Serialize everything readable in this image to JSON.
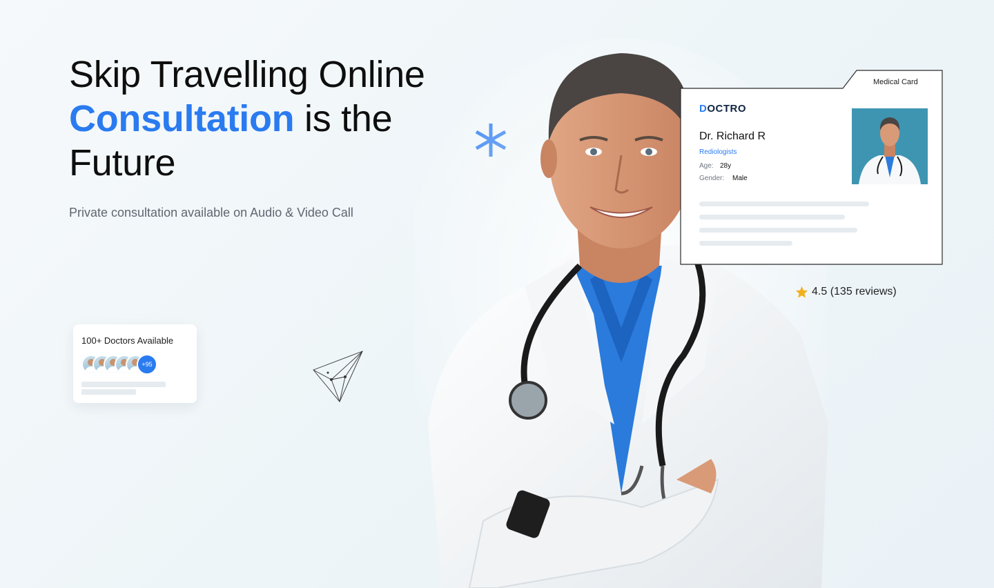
{
  "hero": {
    "title_line1": "Skip Travelling Online",
    "title_accent": "Consultation",
    "title_rest": " is the",
    "title_line3": "Future",
    "subtitle": "Private consultation available on Audio & Video Call"
  },
  "doctors_card": {
    "label": "100+ Doctors Available",
    "more_count": "+95"
  },
  "medical_card": {
    "tab_label": "Medical Card",
    "logo_first": "D",
    "logo_rest": "OCTRO",
    "doctor_name": "Dr. Richard R",
    "specialty": "Rediologists",
    "age_label": "Age:",
    "age_value": "28y",
    "gender_label": "Gender:",
    "gender_value": "Male"
  },
  "rating": {
    "text": "4.5 (135 reviews)",
    "icon": "star-icon"
  },
  "colors": {
    "accent": "#2a7bf0",
    "star": "#f2b01e",
    "background": "#eef5f8"
  }
}
